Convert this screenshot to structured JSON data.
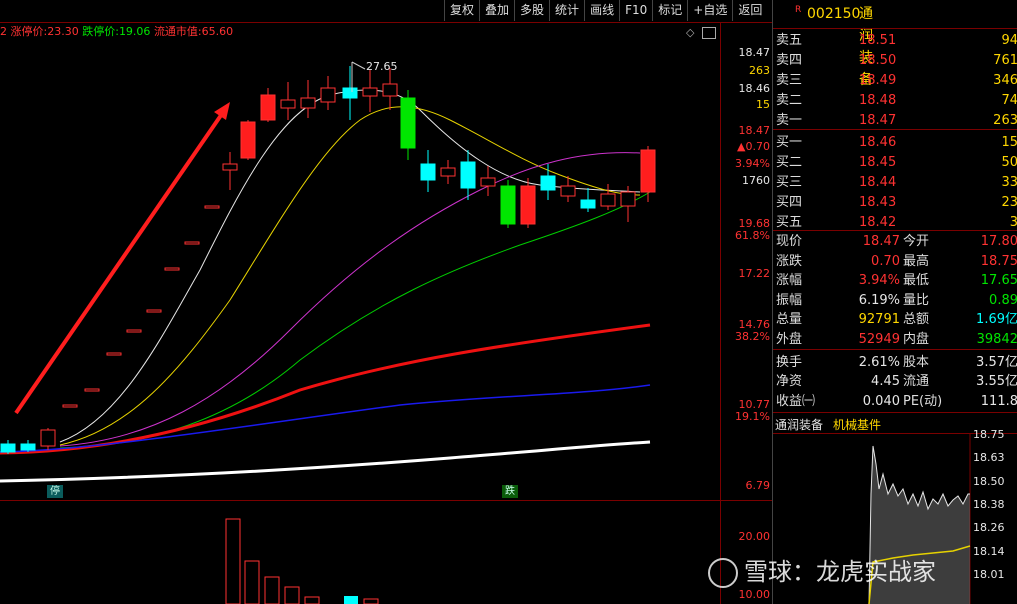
{
  "toolbar": {
    "items": [
      "复权",
      "叠加",
      "多股",
      "统计",
      "画线",
      "F10",
      "标记",
      "+自选",
      "返回"
    ]
  },
  "info": {
    "prefix": "2",
    "limit_up_label": "涨停价:",
    "limit_up": "23.30",
    "limit_down_label": "跌停价:",
    "limit_down": "19.06",
    "float_mv_label": "流通市值:",
    "float_mv": "65.60"
  },
  "kchart": {
    "high_label": "27.65",
    "tag_ting": "停",
    "tag_die": "跌"
  },
  "price_axis": {
    "top": [
      "18.47",
      "263",
      "18.46",
      "15",
      "18.47",
      "▲0.70",
      "3.94%",
      "1760"
    ],
    "scale": [
      "19.68",
      "61.8%",
      "17.22",
      "14.76",
      "38.2%",
      "10.77",
      "19.1%",
      "6.79"
    ],
    "volume": [
      "20.00",
      "10.00"
    ]
  },
  "quote": {
    "r_badge": "R",
    "code": "002150",
    "name": "通润装备"
  },
  "orderbook": [
    {
      "label": "卖五",
      "price": "18.51",
      "vol": "94"
    },
    {
      "label": "卖四",
      "price": "18.50",
      "vol": "761"
    },
    {
      "label": "卖三",
      "price": "18.49",
      "vol": "346"
    },
    {
      "label": "卖二",
      "price": "18.48",
      "vol": "74"
    },
    {
      "label": "卖一",
      "price": "18.47",
      "vol": "263"
    },
    {
      "label": "买一",
      "price": "18.46",
      "vol": "15"
    },
    {
      "label": "买二",
      "price": "18.45",
      "vol": "50"
    },
    {
      "label": "买三",
      "price": "18.44",
      "vol": "33"
    },
    {
      "label": "买四",
      "price": "18.43",
      "vol": "23"
    },
    {
      "label": "买五",
      "price": "18.42",
      "vol": "3"
    }
  ],
  "stats": [
    {
      "l1": "现价",
      "v1": "18.47",
      "c1": "red",
      "l2": "今开",
      "v2": "17.80",
      "c2": "red"
    },
    {
      "l1": "涨跌",
      "v1": "0.70",
      "c1": "red",
      "l2": "最高",
      "v2": "18.75",
      "c2": "red"
    },
    {
      "l1": "涨幅",
      "v1": "3.94%",
      "c1": "red",
      "l2": "最低",
      "v2": "17.65",
      "c2": "green"
    },
    {
      "l1": "振幅",
      "v1": "6.19%",
      "c1": "white",
      "l2": "量比",
      "v2": "0.89",
      "c2": "green"
    },
    {
      "l1": "总量",
      "v1": "92791",
      "c1": "yellow",
      "l2": "总额",
      "v2": "1.69亿",
      "c2": "cyan"
    },
    {
      "l1": "外盘",
      "v1": "52949",
      "c1": "red",
      "l2": "内盘",
      "v2": "39842",
      "c2": "green"
    },
    {
      "l1": "换手",
      "v1": "2.61%",
      "c1": "white",
      "l2": "股本",
      "v2": "3.57亿",
      "c2": "white"
    },
    {
      "l1": "净资",
      "v1": "4.45",
      "c1": "white",
      "l2": "流通",
      "v2": "3.55亿",
      "c2": "white"
    },
    {
      "l1": "收益㈠",
      "v1": "0.040",
      "c1": "white",
      "l2": "PE(动)",
      "v2": "111.8",
      "c2": "white"
    }
  ],
  "mini": {
    "name": "通润装备",
    "sector": "机械基件",
    "axis": [
      "18.75",
      "18.63",
      "18.50",
      "18.38",
      "18.26",
      "18.14",
      "18.01"
    ]
  },
  "watermark": "雪球：龙虎实战家",
  "colors": {
    "up": "#ff3232",
    "down": "#00ffff",
    "flat": "#00e600"
  }
}
